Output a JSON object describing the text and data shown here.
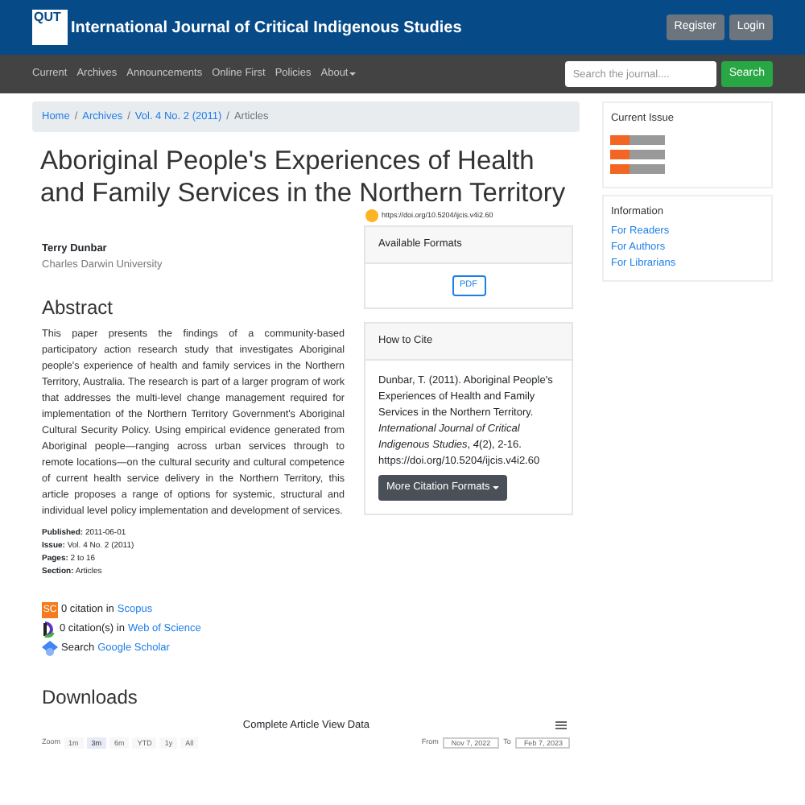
{
  "header": {
    "logo": "QUT",
    "title": "International Journal of Critical Indigenous Studies",
    "buttons": [
      "Register",
      "Login"
    ]
  },
  "nav": {
    "items": [
      {
        "label": "Current",
        "dropdown": false
      },
      {
        "label": "Archives",
        "dropdown": false
      },
      {
        "label": "Announcements",
        "dropdown": false
      },
      {
        "label": "Online First",
        "dropdown": false
      },
      {
        "label": "Policies",
        "dropdown": false
      },
      {
        "label": "About",
        "dropdown": true
      }
    ],
    "search": {
      "placeholder": "Search the journal....",
      "button": "Search"
    }
  },
  "breadcrumb": [
    {
      "label": "Home",
      "link": true
    },
    {
      "separator": "/",
      "label": "Archives",
      "link": true
    },
    {
      "separator": "/",
      "label": "Vol. 4 No. 2 (2011)",
      "link": true
    },
    {
      "separator": "/",
      "label": "Articles",
      "link": false
    }
  ],
  "article": {
    "title": "Aboriginal People's Experiences of Health and Family Services in the Northern Territory",
    "doi": "https://doi.org/10.5204/ijcis.v4i2.60",
    "author": "Terry Dunbar",
    "affiliation": "Charles Darwin University",
    "abstract_heading": "Abstract",
    "abstract": "This paper presents the findings of a community-based participatory action research study that investigates Aboriginal people's experience of health and family services in the Northern Territory, Australia. The research is part of a larger program of work that addresses the multi-level change management required for implementation of the Northern Territory Government's Aboriginal Cultural Security Policy. Using empirical evidence generated from Aboriginal people—ranging across urban services through to remote locations—on the cultural security and cultural competence of current health service delivery in the Northern Territory, this article proposes a range of options for systemic, structural and individual level policy implementation and development of services.",
    "meta": [
      {
        "label": "Published:",
        "value": "2011-06-01"
      },
      {
        "label": "Issue:",
        "value": "Vol. 4 No. 2 (2011)"
      },
      {
        "label": "Pages:",
        "value": "2 to 16"
      },
      {
        "label": "Section:",
        "value": "Articles"
      }
    ],
    "citations": [
      {
        "kind": "scopus",
        "icon_text": "SC",
        "text": "0 citation in",
        "link": "Scopus"
      },
      {
        "kind": "wos",
        "text": "0 citation(s) in",
        "link": "Web of Science"
      },
      {
        "kind": "scholar",
        "text": "Search",
        "link": "Google Scholar"
      }
    ]
  },
  "formats": {
    "heading": "Available Formats",
    "buttons": [
      "PDF"
    ]
  },
  "cite": {
    "heading": "How to Cite",
    "text": "Dunbar, T. (2011). Aboriginal People's Experiences of Health and Family Services in the Northern Territory. *International Journal of Critical Indigenous Studies*, *4*(2), 2-16. https://doi.org/10.5204/ijcis.v4i2.60",
    "button": "More Citation Formats"
  },
  "downloads": {
    "heading": "Downloads",
    "chart_title": "Complete Article View Data",
    "zoom_label": "Zoom",
    "ranges": [
      {
        "label": "1m",
        "selected": false
      },
      {
        "label": "3m",
        "selected": true
      },
      {
        "label": "6m",
        "selected": false
      },
      {
        "label": "YTD",
        "selected": false
      },
      {
        "label": "1y",
        "selected": false
      },
      {
        "label": "All",
        "selected": false
      }
    ],
    "from_label": "From",
    "from": "Nov 7, 2022",
    "to_label": "To",
    "to": "Feb 7, 2023"
  },
  "sidebar": {
    "current_issue": {
      "heading": "Current Issue",
      "feeds": [
        {
          "color": "#f26522"
        },
        {
          "color": "#f26522"
        },
        {
          "color": "#f26522"
        }
      ]
    },
    "information": {
      "heading": "Information",
      "links": [
        "For Readers",
        "For Authors",
        "For Librarians"
      ]
    }
  }
}
